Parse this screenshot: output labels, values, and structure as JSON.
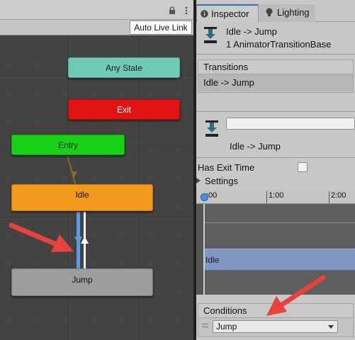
{
  "graph": {
    "toolbar": {
      "auto_live_link": "Auto Live Link"
    },
    "nodes": {
      "any_state": "Any State",
      "exit": "Exit",
      "entry": "Entry",
      "idle": "Idle",
      "jump": "Jump"
    }
  },
  "inspector": {
    "tabs": [
      {
        "label": "Inspector",
        "icon": "info-icon",
        "active": true
      },
      {
        "label": "Lighting",
        "icon": "lightbulb-icon",
        "active": false
      }
    ],
    "header": {
      "title": "Idle -> Jump",
      "subtitle": "1 AnimatorTransitionBase"
    },
    "transitions": {
      "header": "Transitions",
      "items": [
        "Idle -> Jump"
      ]
    },
    "transition": {
      "name_value": "",
      "label": "Idle -> Jump"
    },
    "has_exit_time": {
      "label": "Has Exit Time",
      "checked": false
    },
    "settings": {
      "label": "Settings",
      "expanded": false
    },
    "timeline": {
      "ticks": [
        ":00",
        "1:00",
        "2:00"
      ],
      "clip_label": "Idle"
    },
    "conditions": {
      "header": "Conditions",
      "items": [
        "Jump"
      ]
    }
  },
  "colors": {
    "any_state": "#6fcab7",
    "exit": "#e21313",
    "entry": "#18d218",
    "idle": "#f39a1c",
    "jump": "#9d9d9d",
    "annotation_arrow": "#e8423e",
    "selected_transition": "#5b9be6"
  }
}
